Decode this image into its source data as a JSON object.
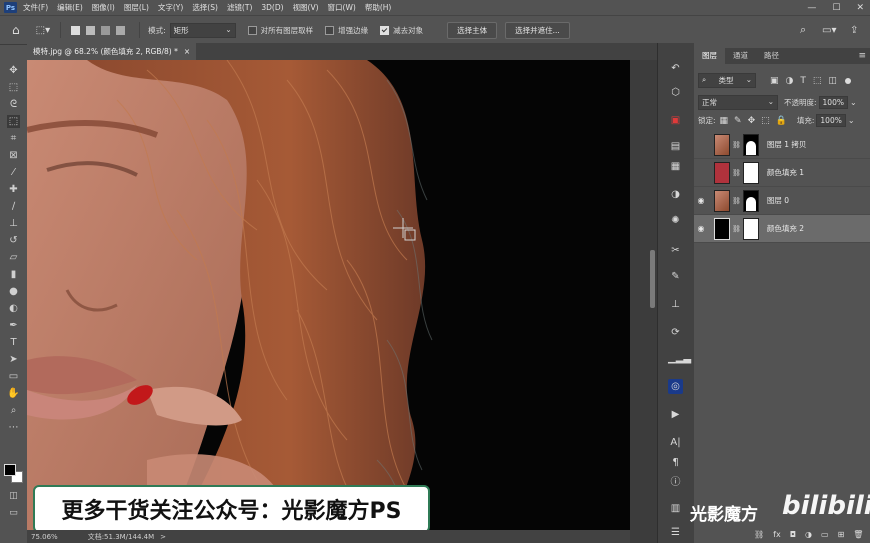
{
  "app": {
    "logo": "Ps"
  },
  "menu": [
    "文件(F)",
    "编辑(E)",
    "图像(I)",
    "图层(L)",
    "文字(Y)",
    "选择(S)",
    "滤镜(T)",
    "3D(D)",
    "视图(V)",
    "窗口(W)",
    "帮助(H)"
  ],
  "window_controls": {
    "minimize": "—",
    "maximize": "☐",
    "close": "✕"
  },
  "options": {
    "mode_label": "模式:",
    "mode_value": "矩形",
    "sample_all_label": "对所有图层取样",
    "enhance_edge_label": "增强边缘",
    "subtract_label": "减去对象",
    "select_subject": "选择主体",
    "select_and_mask": "选择并遮住..."
  },
  "document": {
    "tab_title": "模特.jpg @ 68.2% (颜色填充 2, RGB/8) *",
    "close": "×"
  },
  "status": {
    "zoom": "75.06%",
    "doc_size": "文档:51.3M/144.4M",
    "arrow": ">"
  },
  "panel": {
    "tabs": [
      "图层",
      "通道",
      "路径"
    ],
    "filter_kind": "类型",
    "blend_mode": "正常",
    "opacity_label": "不透明度:",
    "opacity_value": "100%",
    "lock_label": "锁定:",
    "fill_label": "填充:",
    "fill_value": "100%",
    "layers": [
      {
        "name": "图层 1 拷贝",
        "visible": false,
        "thumb_color": "#9c5a42",
        "selected": false
      },
      {
        "name": "颜色填充 1",
        "visible": false,
        "thumb_color": "#b0323c",
        "selected": false
      },
      {
        "name": "图层 0",
        "visible": true,
        "thumb_color": "#9c5a42",
        "selected": false
      },
      {
        "name": "颜色填充 2",
        "visible": true,
        "thumb_color": "#000000",
        "selected": true
      }
    ]
  },
  "subtitle": "更多干货关注公众号：光影魔方PS",
  "watermark": {
    "channel": "光影魔方",
    "site": "bilibili"
  },
  "colors": {
    "accent": "#2f7b56",
    "foreground": "#000000",
    "background": "#ffffff"
  }
}
